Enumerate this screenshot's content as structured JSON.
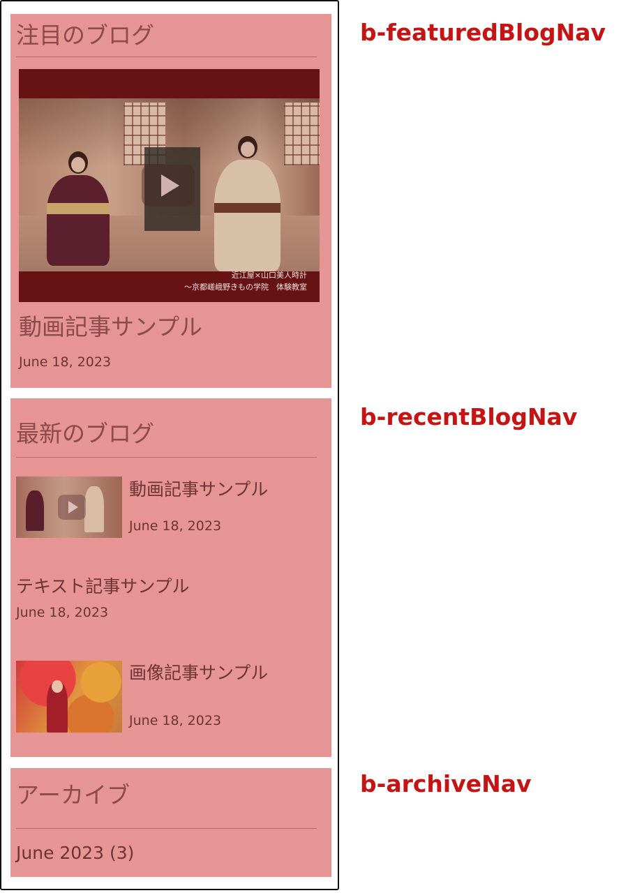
{
  "featured": {
    "title": "注目のブログ",
    "video_caption_line1": "近江屋×山口美人時計",
    "video_caption_line2": "～京都嵯峨野きもの学院　体験教室",
    "post_title": "動画記事サンプル",
    "post_date": "June 18, 2023"
  },
  "recent": {
    "title": "最新のブログ",
    "items": [
      {
        "title": "動画記事サンプル",
        "date": "June 18, 2023",
        "thumb": "video"
      },
      {
        "title": "テキスト記事サンプル",
        "date": "June 18, 2023",
        "thumb": "none"
      },
      {
        "title": "画像記事サンプル",
        "date": "June 18, 2023",
        "thumb": "image"
      }
    ]
  },
  "archive": {
    "title": "アーカイブ",
    "items": [
      {
        "label": "June 2023 (3)"
      }
    ]
  },
  "annotations": {
    "featured": "b-featuredBlogNav",
    "recent": "b-recentBlogNav",
    "archive": "b-archiveNav"
  },
  "colors": {
    "panel_bg": "#e69494",
    "annotation": "#c41414",
    "video_letterbox": "#671313"
  },
  "icons": {
    "video_play": "play-icon"
  }
}
